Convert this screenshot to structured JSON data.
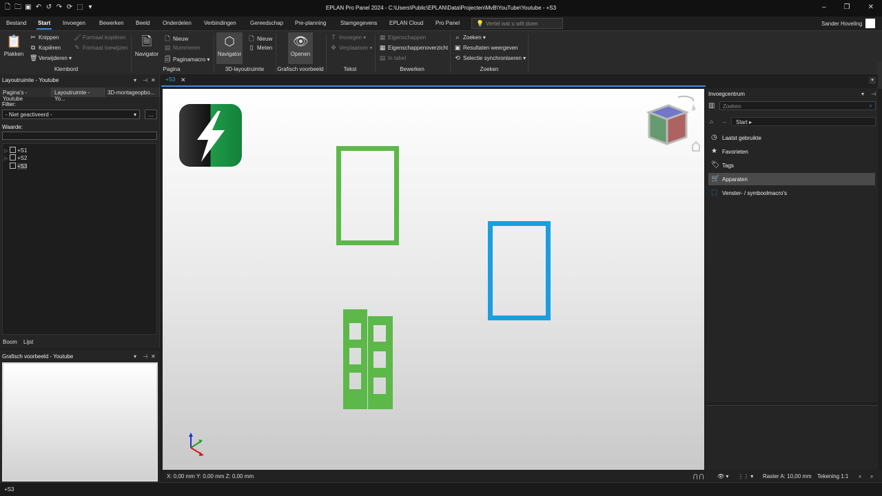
{
  "window": {
    "title": "EPLAN Pro Panel 2024 - C:\\Users\\Public\\EPLAN\\Data\\Projecten\\MvB\\YouTube\\Youtube - +S3"
  },
  "ribbon_tabs": [
    "Bestand",
    "Start",
    "Invoegen",
    "Bewerken",
    "Beeld",
    "Onderdelen",
    "Verbindingen",
    "Gereedschap",
    "Pre-planning",
    "Stamgegevens",
    "EPLAN Cloud",
    "Pro Panel"
  ],
  "tell_me": {
    "placeholder": "Vertel wat u wilt doen"
  },
  "user": {
    "name": "Sander Hoveling"
  },
  "ribbon": {
    "paste": "Plakken",
    "cut": "Knippen",
    "copy": "Kopiëren",
    "delete": "Verwijderen",
    "format_copy": "Formaat kopiëren",
    "format_apply": "Formaat toewijzen",
    "group_clipboard": "Klembord",
    "navigator": "Navigator",
    "page_new": "Nieuw",
    "page_number": "Nummeren",
    "page_macro": "Paginamacro",
    "group_page": "Pagina",
    "layout_navigator": "Navigator",
    "layout_new": "Nieuw",
    "layout_measure": "Meten",
    "group_3d": "3D-layoutruimte",
    "open": "Openen",
    "group_preview": "Grafisch voorbeeld",
    "text_insert": "Invoegen",
    "text_move": "Verplaatsen",
    "group_text": "Tekst",
    "properties": "Eigenschappen",
    "properties_overview": "Eigenschappenoverzicht",
    "in_table": "In tabel",
    "group_edit": "Bewerken",
    "search": "Zoeken",
    "show_results": "Resultaten weergeven",
    "sync_selection": "Selectie synchroniseren",
    "group_search": "Zoeken"
  },
  "left_panel": {
    "title": "Layoutruimte - Youtube",
    "subtabs": [
      "Pagina's - Youtube",
      "Layoutruimte - Yo...",
      "3D-montageopbo..."
    ],
    "filter_label": "Filter:",
    "filter_value": "- Niet geactiveerd -",
    "filter_more": "...",
    "value_label": "Waarde:",
    "tree": [
      "+S1",
      "+S2",
      "+S3"
    ],
    "bottom_tabs": [
      "Boom",
      "Lijst"
    ]
  },
  "preview_panel": {
    "title": "Grafisch voorbeeld - Youtube"
  },
  "document": {
    "tab": "+S3"
  },
  "status": {
    "coords": "X: 0,00 mm Y: 0,00 mm Z: 0,00 mm",
    "grid": "Raster A: 10,00 mm",
    "drawing": "Tekening 1:1"
  },
  "bottom_status": "+S3",
  "right_panel": {
    "title": "Invoegcentrum",
    "search_placeholder": "Zoeken",
    "breadcrumb": "Start",
    "items": [
      "Laatst gebruikte",
      "Favorieten",
      "Tags",
      "Apparaten",
      "Venster- / symboolmacro's"
    ]
  },
  "colors": {
    "accent": "#3a8de0",
    "green_part": "#5db84a",
    "blue_part": "#1a9ee0",
    "logo_green": "#1f9a48"
  },
  "icons": {
    "paste": "clipboard-icon",
    "cut": "scissors-icon",
    "copy": "copy-icon",
    "delete": "trash-icon",
    "open": "eye-icon",
    "search": "magnifier-icon",
    "recent": "clock-icon",
    "favorites": "star-icon",
    "tags": "bookmark-icon",
    "devices": "cart-icon",
    "macros": "macro-icon"
  }
}
